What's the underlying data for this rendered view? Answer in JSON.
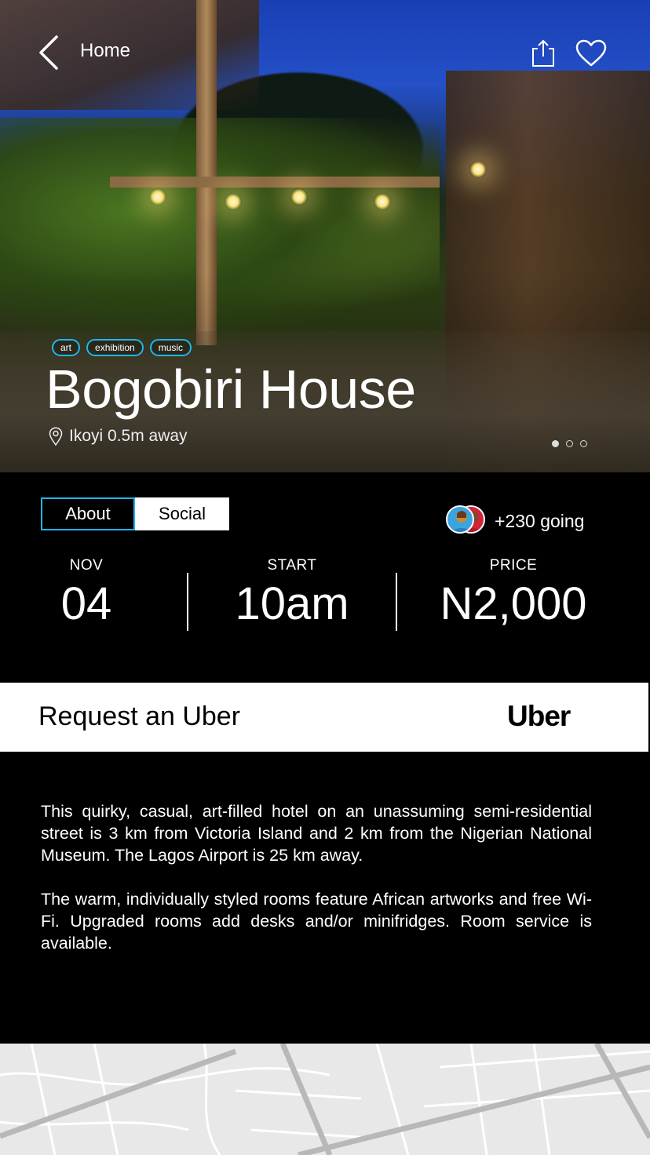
{
  "header": {
    "back_label": "Home"
  },
  "hero": {
    "tags": [
      "art",
      "exhibition",
      "music"
    ],
    "title": "Bogobiri House",
    "location": "Ikoyi 0.5m away",
    "image_count": 3,
    "active_image_index": 0
  },
  "tabs": [
    {
      "label": "About",
      "selected": true
    },
    {
      "label": "Social",
      "selected": false
    }
  ],
  "attendance": {
    "going_text": "+230 going"
  },
  "stats": {
    "date": {
      "label": "NOV",
      "value": "04"
    },
    "start": {
      "label": "START",
      "value": "10am"
    },
    "price": {
      "label": "PRICE",
      "value": "N2,000"
    }
  },
  "uber": {
    "request_label": "Request an Uber",
    "logo_text": "Uber"
  },
  "description": {
    "paragraphs": [
      "This quirky, casual, art-filled hotel on an unassuming semi-residential street is 3 km from Victoria Island and 2 km from the Nigerian National Museum. The Lagos Airport is 25 km away.",
      "The warm, individually styled rooms feature African artworks and free Wi-Fi. Upgraded rooms add desks and/or minifridges. Room service is available."
    ]
  },
  "colors": {
    "accent": "#1fb6f0",
    "background": "#000000",
    "map": "#e6e6e6"
  }
}
